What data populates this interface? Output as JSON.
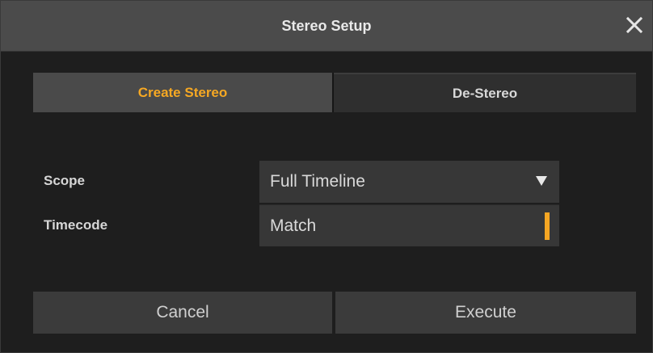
{
  "window": {
    "title": "Stereo Setup",
    "close_icon": "close-icon"
  },
  "tabs": [
    {
      "label": "Create Stereo",
      "active": true
    },
    {
      "label": "De-Stereo",
      "active": false
    }
  ],
  "form": {
    "scope": {
      "label": "Scope",
      "value": "Full Timeline",
      "icon": "dropdown-triangle-icon"
    },
    "timecode": {
      "label": "Timecode",
      "value": "Match",
      "indicator": "orange-bar"
    }
  },
  "buttons": {
    "cancel": "Cancel",
    "execute": "Execute"
  },
  "colors": {
    "accent": "#f5a623",
    "titlebar": "#4b4b4b",
    "background": "#1e1e1e",
    "field": "#373737",
    "button": "#3b3b3b"
  }
}
